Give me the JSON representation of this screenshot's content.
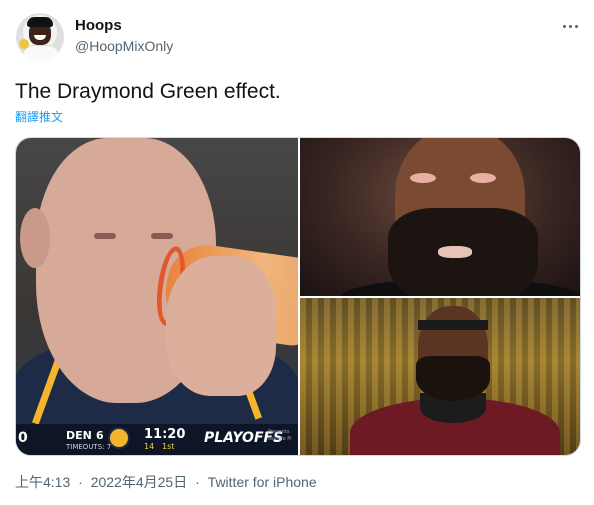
{
  "author": {
    "name": "Hoops",
    "handle": "@HoopMixOnly",
    "avatar_icon": "profile-avatar"
  },
  "tweet": {
    "text": "The Draymond Green effect.",
    "translate_label": "翻譯推文"
  },
  "media": {
    "scorebug": {
      "quarter": "0",
      "team": "DEN",
      "score": "6",
      "timeouts": "TIMEOUTS: 7",
      "clock": "11:20",
      "shot_clock": "14",
      "period": "1st",
      "playoffs": "PLAYOFFS",
      "tag": "Presents Google Pi"
    }
  },
  "meta": {
    "time": "上午4:13",
    "date": "2022年4月25日",
    "source": "Twitter for iPhone",
    "separator": "·"
  },
  "colors": {
    "accent": "#1d9bf0",
    "secondary_text": "#536471",
    "primary_text": "#0f1419"
  }
}
